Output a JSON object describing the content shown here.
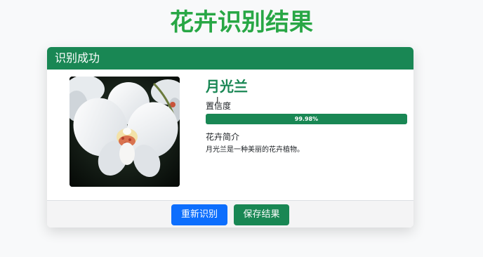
{
  "page": {
    "title": "花卉识别结果"
  },
  "card": {
    "header": "识别成功",
    "image_icon": "orchid-flower-photo",
    "flower_name": "月光兰",
    "confidence_label": "置信度",
    "confidence_value": "99.98%",
    "confidence_fraction": 0.9998,
    "intro_label": "花卉简介",
    "intro_text": "月光兰是一种美丽的花卉植物。"
  },
  "actions": {
    "retry_label": "重新识别",
    "save_label": "保存结果"
  },
  "colors": {
    "title": "#28a745",
    "accent": "#198754",
    "primary_button": "#0d6efd"
  }
}
